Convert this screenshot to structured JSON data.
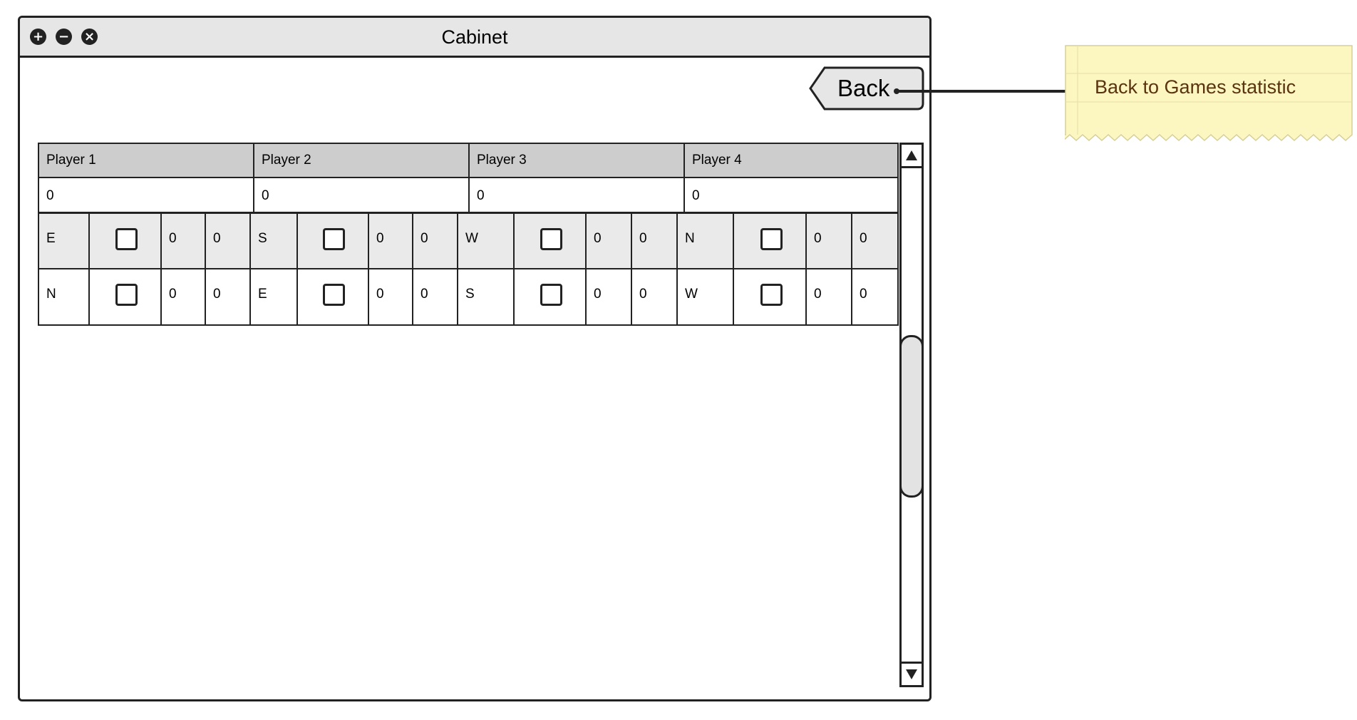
{
  "window": {
    "title": "Cabinet",
    "controls": [
      {
        "name": "maximize",
        "glyph": "+"
      },
      {
        "name": "minimize",
        "glyph": "−"
      },
      {
        "name": "close",
        "glyph": "×"
      }
    ]
  },
  "back_button": {
    "label": "Back"
  },
  "note": {
    "text": "Back to Games statistic",
    "color": "#fcf6c0"
  },
  "table": {
    "players": [
      {
        "name": "Player 1",
        "total": "0"
      },
      {
        "name": "Player 2",
        "total": "0"
      },
      {
        "name": "Player 3",
        "total": "0"
      },
      {
        "name": "Player 4",
        "total": "0"
      }
    ],
    "rows": [
      [
        {
          "wind": "E",
          "checked": false,
          "a": "0",
          "b": "0"
        },
        {
          "wind": "S",
          "checked": false,
          "a": "0",
          "b": "0"
        },
        {
          "wind": "W",
          "checked": false,
          "a": "0",
          "b": "0"
        },
        {
          "wind": "N",
          "checked": false,
          "a": "0",
          "b": "0"
        }
      ],
      [
        {
          "wind": "N",
          "checked": false,
          "a": "0",
          "b": "0"
        },
        {
          "wind": "E",
          "checked": false,
          "a": "0",
          "b": "0"
        },
        {
          "wind": "S",
          "checked": false,
          "a": "0",
          "b": "0"
        },
        {
          "wind": "W",
          "checked": false,
          "a": "0",
          "b": "0"
        }
      ]
    ]
  },
  "colors": {
    "frame": "#222222",
    "titlebar": "#e6e6e6",
    "header": "#cdcdcd",
    "row_alt": "#eaeaea"
  }
}
